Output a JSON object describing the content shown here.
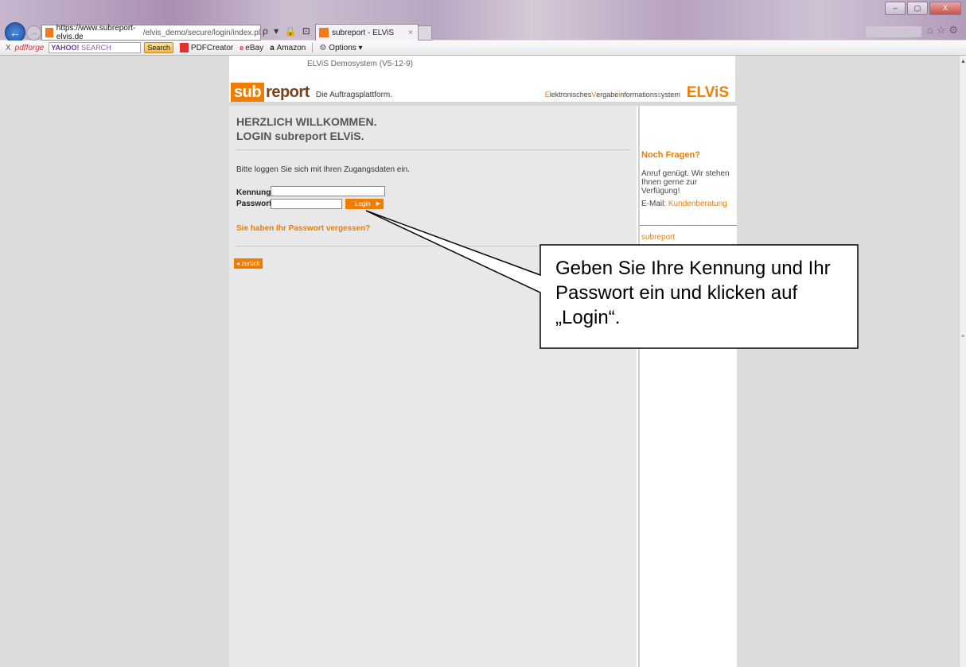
{
  "browser": {
    "url_host": "https://www.subreport-elvis.de",
    "url_path": "/elvis_demo/secure/login/index.pl",
    "address_controls": "ρ ▾ 🔒 ⊡ ↻ ✕",
    "tab_title": "subreport - ELViS",
    "tab_close": "×",
    "window_buttons": [
      "–",
      "▢",
      "X"
    ]
  },
  "toolbar": {
    "close": "X",
    "pdfforge": "pdfforge",
    "yahoo_placeholder": "SEARCH",
    "yahoo_brand": "YAHOO!",
    "search_button": "Search",
    "pdfcreator": "PDFCreator",
    "ebay": "eBay",
    "amazon": "Amazon",
    "options": "Options ▾"
  },
  "site": {
    "demo_line": "ELViS Demosystem (V5-12-9)",
    "logo_sub": "sub",
    "logo_report": "report",
    "tagline": "Die Auftragsplattform.",
    "elvis_full_parts": [
      "E",
      "lektronisches ",
      "V",
      "ergabe",
      "i",
      "nformations",
      "s",
      "ystem"
    ],
    "elvis_logo": "ELViS"
  },
  "login": {
    "heading1": "HERZLICH WILLKOMMEN.",
    "heading2": "LOGIN subreport ELViS.",
    "instruction": "Bitte loggen Sie sich mit Ihren Zugangsdaten ein.",
    "kennung_label": "Kennung",
    "passwort_label": "Passwort",
    "kennung_value": "",
    "passwort_value": "",
    "login_button": "Login",
    "forgot_link": "Sie haben Ihr Passwort vergessen?",
    "back_button": "◂ zurück"
  },
  "sidebar": {
    "question": "Noch Fragen?",
    "text": "Anruf genügt. Wir stehen Ihnen gerne zur Verfügung!",
    "email_label": "E-Mail: ",
    "email_link": "Kundenberatung",
    "company": "subreport"
  },
  "callout": {
    "text": "Geben Sie Ihre Kennung und Ihr Passwort ein und klicken auf „Login“."
  },
  "colors": {
    "accent": "#ee7d00",
    "logo_brown": "#7a3f1b"
  }
}
